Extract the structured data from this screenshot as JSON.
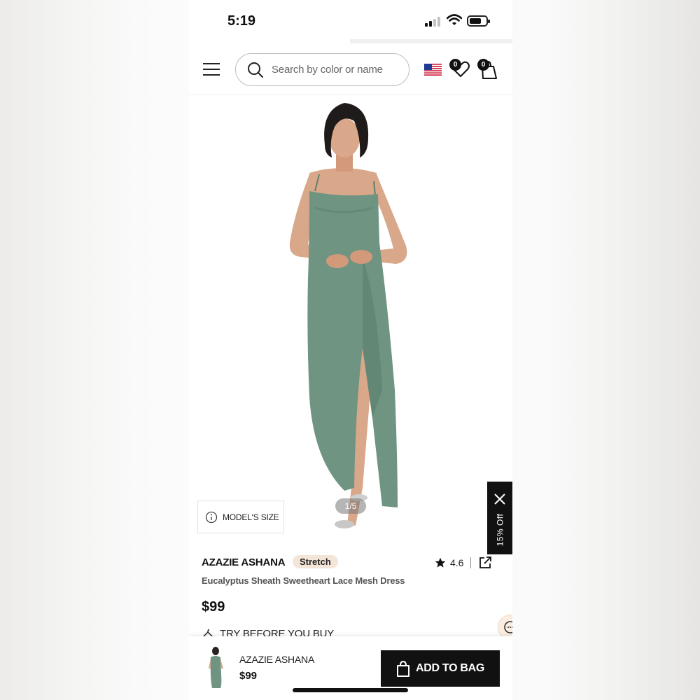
{
  "status_bar": {
    "time": "5:19"
  },
  "header": {
    "search_placeholder": "Search by color or name",
    "wishlist_count": "0",
    "bag_count": "0"
  },
  "gallery": {
    "model_size_label": "MODEL'S SIZE",
    "image_counter": "1/5",
    "promo_label": "15% Off"
  },
  "product": {
    "brand": "AZAZIE ASHANA",
    "badge": "Stretch",
    "rating": "4.6",
    "name": "Eucalyptus Sheath Sweetheart Lace Mesh Dress",
    "price": "$99",
    "try_before_label": "TRY BEFORE YOU BUY",
    "dress_color": "#6f9481"
  },
  "bottom_bar": {
    "brand": "AZAZIE ASHANA",
    "price": "$99",
    "add_to_bag_label": "ADD TO BAG"
  },
  "icons": [
    "menu-icon",
    "search-icon",
    "us-flag-icon",
    "heart-icon",
    "shopping-bag-icon",
    "info-icon",
    "close-icon",
    "star-icon",
    "share-icon",
    "hanger-icon",
    "chat-icon"
  ]
}
